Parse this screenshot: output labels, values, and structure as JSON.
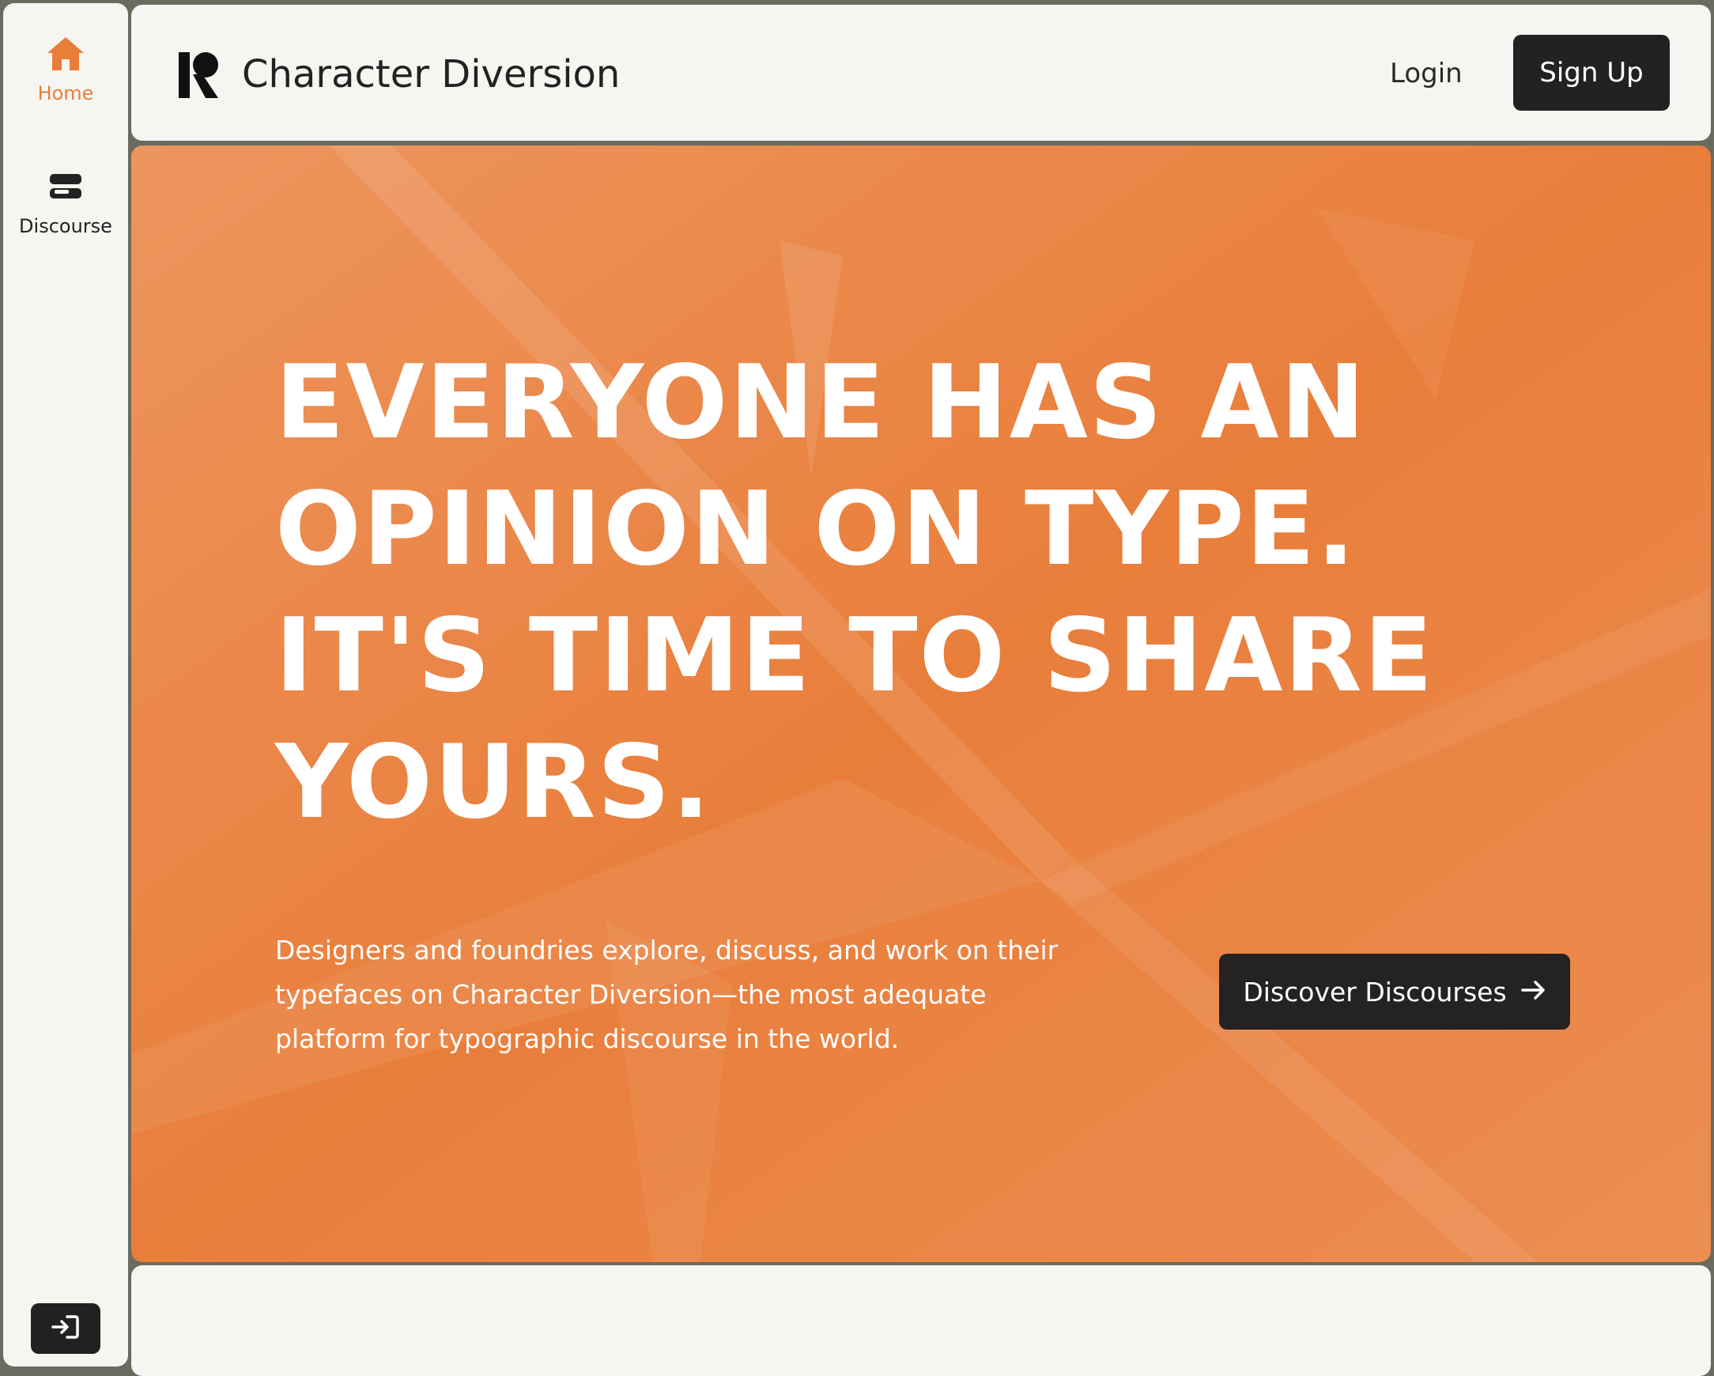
{
  "sidebar": {
    "items": [
      {
        "label": "Home",
        "icon": "home-icon",
        "active": true
      },
      {
        "label": "Discourse",
        "icon": "discourse-icon",
        "active": false
      }
    ],
    "login_icon": "login-icon"
  },
  "header": {
    "brand": "Character Diversion",
    "logo_icon": "brand-logo-icon",
    "login_label": "Login",
    "signup_label": "Sign Up"
  },
  "hero": {
    "headline_lines": [
      "EVERYONE HAS AN",
      "OPINION ON TYPE.",
      "IT'S TIME TO SHARE",
      "YOURS."
    ],
    "subtext": "Designers and foundries explore, discuss, and work on their typefaces on Character Diversion—the most adequate platform for typographic discourse in the world.",
    "cta_label": "Discover Discourses",
    "cta_icon": "arrow-right-icon"
  },
  "colors": {
    "accent": "#e97e3b",
    "dark": "#232222",
    "panel": "#f6f5f1",
    "frame": "#6b6a5e"
  }
}
